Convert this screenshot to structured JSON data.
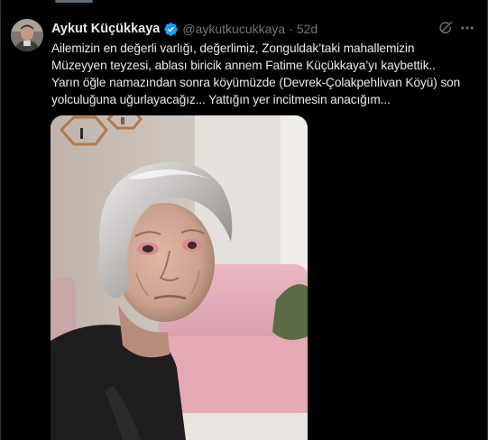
{
  "tweet": {
    "author": {
      "display_name": "Aykut Küçükkaya",
      "handle": "@aykutkucukkaya",
      "verified": true,
      "verified_color": "#1d9bf0"
    },
    "separator": "·",
    "time": "52d",
    "text_lines": [
      "Ailemizin en değerli varlığı, değerlimiz, Zonguldak’taki mahallemizin",
      "Müzeyyen teyzesi, ablası biricik annem Fatime Küçükkaya’yı kaybettik..",
      "Yarın öğle namazından sonra köyümüzde (Devrek-Çolakpehlivan Köyü)  son",
      "yolculuğuna uğurlayacağız... Yattığın yer incitmesin anacığım..."
    ],
    "actions": {
      "grok_icon": "grok-icon",
      "more_icon": "more-dots-icon"
    },
    "media": {
      "kind": "photo"
    }
  },
  "colors": {
    "background": "#000000",
    "text_primary": "#e7e9ea",
    "text_secondary": "#71767b",
    "border": "#2f3336"
  }
}
